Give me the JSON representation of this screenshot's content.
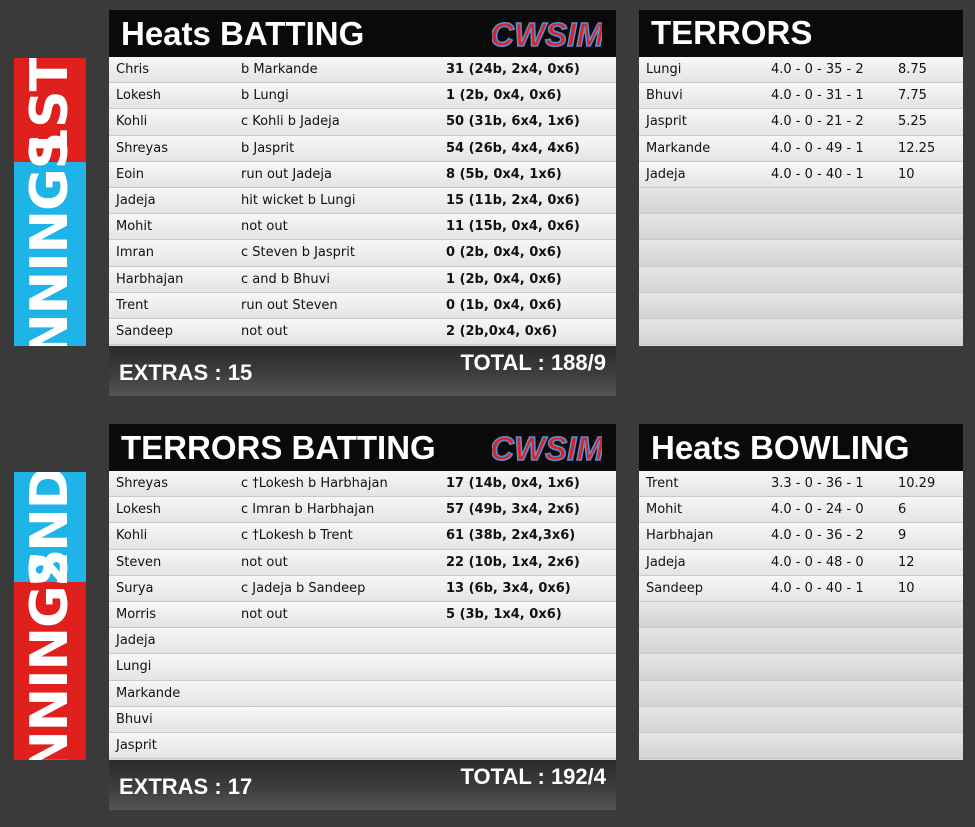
{
  "innings1": {
    "tab_top": "1ST",
    "tab_bottom": "INNINGS",
    "batting_title": "Heats BATTING",
    "logo": "CWSIM",
    "batting": [
      {
        "name": "Chris",
        "dismissal": "b Markande",
        "score": "31 (24b, 2x4, 0x6)"
      },
      {
        "name": "Lokesh",
        "dismissal": "b Lungi",
        "score": "1 (2b, 0x4, 0x6)"
      },
      {
        "name": "Kohli",
        "dismissal": "c Kohli b Jadeja",
        "score": "50 (31b, 6x4, 1x6)"
      },
      {
        "name": "Shreyas",
        "dismissal": "b Jasprit",
        "score": "54 (26b, 4x4, 4x6)"
      },
      {
        "name": "Eoin",
        "dismissal": "run out Jadeja",
        "score": "8 (5b, 0x4, 1x6)"
      },
      {
        "name": "Jadeja",
        "dismissal": "hit wicket b Lungi",
        "score": "15 (11b, 2x4, 0x6)"
      },
      {
        "name": "Mohit",
        "dismissal": "not out",
        "score": "11 (15b, 0x4, 0x6)"
      },
      {
        "name": "Imran",
        "dismissal": "c Steven b Jasprit",
        "score": "0 (2b, 0x4, 0x6)"
      },
      {
        "name": "Harbhajan",
        "dismissal": "c and b Bhuvi",
        "score": "1 (2b, 0x4, 0x6)"
      },
      {
        "name": "Trent",
        "dismissal": "run out Steven",
        "score": "0 (1b, 0x4, 0x6)"
      },
      {
        "name": "Sandeep",
        "dismissal": "not out",
        "score": "2 (2b,0x4, 0x6)"
      }
    ],
    "extras": "EXTRAS : 15",
    "total": "TOTAL : 188/9",
    "bowling_title": "TERRORS",
    "bowling": [
      {
        "name": "Lungi",
        "figures": "4.0 - 0 - 35 - 2",
        "econ": "8.75"
      },
      {
        "name": "Bhuvi",
        "figures": "4.0 - 0 - 31 - 1",
        "econ": "7.75"
      },
      {
        "name": "Jasprit",
        "figures": "4.0 - 0 - 21 - 2",
        "econ": "5.25"
      },
      {
        "name": "Markande",
        "figures": "4.0 - 0 - 49 - 1",
        "econ": "12.25"
      },
      {
        "name": "Jadeja",
        "figures": "4.0 - 0 - 40 - 1",
        "econ": "10"
      }
    ]
  },
  "innings2": {
    "tab_top": "2ND",
    "tab_bottom": "INNINGS",
    "batting_title": "TERRORS BATTING",
    "logo": "CWSIM",
    "batting": [
      {
        "name": "Shreyas",
        "dismissal": "c †Lokesh b Harbhajan",
        "score": "17 (14b, 0x4, 1x6)"
      },
      {
        "name": "Lokesh",
        "dismissal": "c Imran b Harbhajan",
        "score": "57 (49b, 3x4, 2x6)"
      },
      {
        "name": "Kohli",
        "dismissal": "c †Lokesh b Trent",
        "score": "61 (38b, 2x4,3x6)"
      },
      {
        "name": "Steven",
        "dismissal": "not out",
        "score": "22 (10b, 1x4, 2x6)"
      },
      {
        "name": "Surya",
        "dismissal": "c Jadeja b Sandeep",
        "score": "13 (6b, 3x4, 0x6)"
      },
      {
        "name": "Morris",
        "dismissal": "not out",
        "score": "5 (3b, 1x4, 0x6)"
      },
      {
        "name": "Jadeja",
        "dismissal": "",
        "score": ""
      },
      {
        "name": "Lungi",
        "dismissal": "",
        "score": ""
      },
      {
        "name": "Markande",
        "dismissal": "",
        "score": ""
      },
      {
        "name": "Bhuvi",
        "dismissal": "",
        "score": ""
      },
      {
        "name": "Jasprit",
        "dismissal": "",
        "score": ""
      }
    ],
    "extras": "EXTRAS : 17",
    "total": "TOTAL : 192/4",
    "bowling_title": "Heats BOWLING",
    "bowling": [
      {
        "name": "Trent",
        "figures": "3.3 - 0 - 36 - 1",
        "econ": "10.29"
      },
      {
        "name": "Mohit",
        "figures": "4.0 - 0 - 24 - 0",
        "econ": "6"
      },
      {
        "name": "Harbhajan",
        "figures": "4.0 - 0 - 36 - 2",
        "econ": "9"
      },
      {
        "name": "Jadeja",
        "figures": "4.0 - 0 - 48 - 0",
        "econ": "12"
      },
      {
        "name": "Sandeep",
        "figures": "4.0 - 0 - 40 - 1",
        "econ": "10"
      }
    ]
  },
  "colors": {
    "tab_blue": "#1eb4e8",
    "tab_red": "#e0201c",
    "logo_red": "#e0201c"
  }
}
